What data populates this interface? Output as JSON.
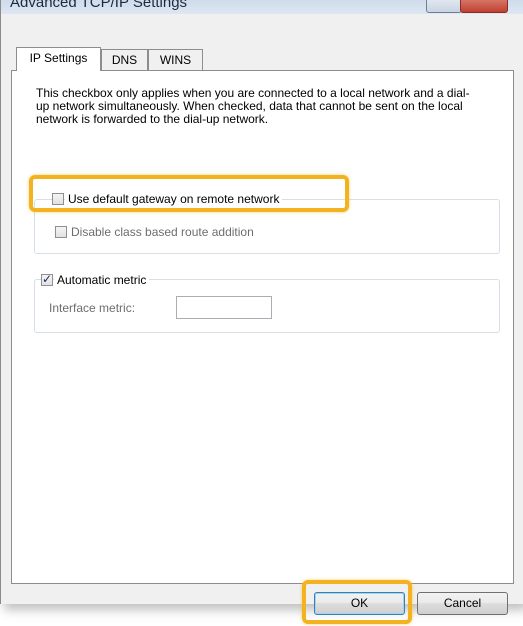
{
  "window": {
    "title": "Advanced TCP/IP Settings"
  },
  "tabs": [
    {
      "label": "IP Settings",
      "active": true
    },
    {
      "label": "DNS",
      "active": false
    },
    {
      "label": "WINS",
      "active": false
    }
  ],
  "panel": {
    "description": "This checkbox only applies when you are connected to a local network and a dial-up network simultaneously.  When checked, data that cannot be sent on the local network is forwarded to the dial-up network.",
    "gateway_group": {
      "use_default_gateway": {
        "label": "Use default gateway on remote network",
        "checked": false
      },
      "disable_class_route": {
        "label": "Disable class based route addition",
        "checked": false
      }
    },
    "metric_group": {
      "automatic_metric": {
        "label": "Automatic metric",
        "checked": true
      },
      "interface_metric": {
        "label": "Interface metric:",
        "value": ""
      }
    }
  },
  "buttons": {
    "ok": "OK",
    "cancel": "Cancel"
  },
  "colors": {
    "highlight": "#f3b321",
    "panel_bg": "#ffffff",
    "window_bg": "#f0f0f0"
  }
}
